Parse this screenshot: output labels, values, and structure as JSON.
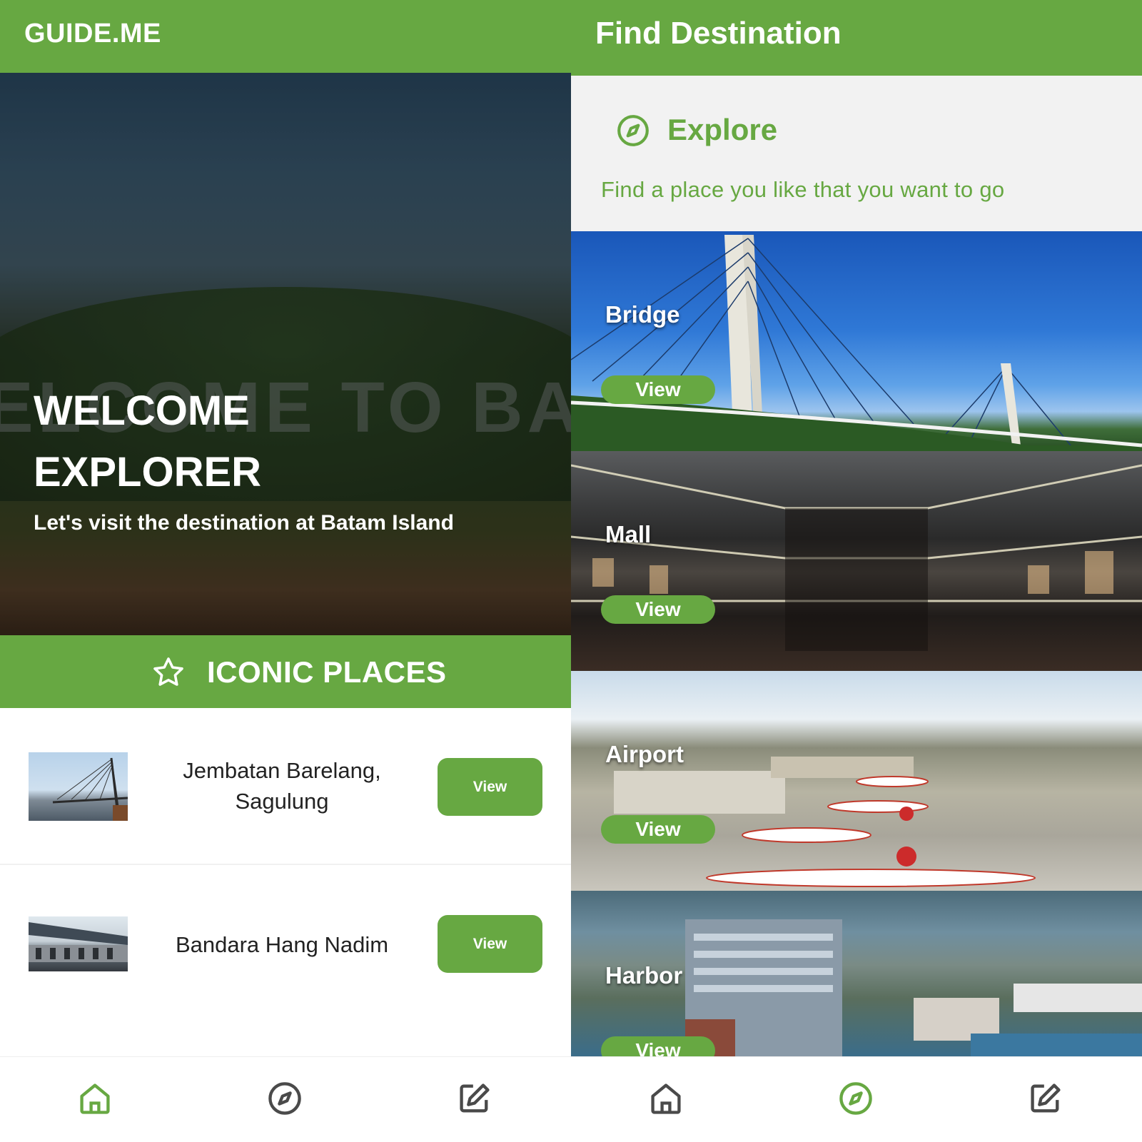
{
  "colors": {
    "primary": "#67a842",
    "white": "#ffffff",
    "panel": "#f2f2f2",
    "text": "#222222"
  },
  "left_screen": {
    "appbar": {
      "title": "GUIDE.ME"
    },
    "hero": {
      "background_sign_text": "ELCOME TO BATA",
      "title_line1": "WELCOME",
      "title_line2": "EXPLORER",
      "subtitle": "Let's visit the destination at Batam Island"
    },
    "section": {
      "icon": "star-icon",
      "title": "ICONIC PLACES"
    },
    "places": [
      {
        "name": "Jembatan Barelang, Sagulung",
        "button": "View"
      },
      {
        "name": "Bandara Hang Nadim",
        "button": "View"
      }
    ],
    "bottom_nav": [
      {
        "icon": "home-icon",
        "active": true
      },
      {
        "icon": "compass-icon",
        "active": false
      },
      {
        "icon": "edit-icon",
        "active": false
      }
    ]
  },
  "right_screen": {
    "appbar": {
      "title": "Find Destination"
    },
    "explore": {
      "icon": "compass-icon",
      "title": "Explore",
      "subtitle": "Find a place you like that you want to go"
    },
    "categories": [
      {
        "name": "Bridge",
        "button": "View"
      },
      {
        "name": "Mall",
        "button": "View"
      },
      {
        "name": "Airport",
        "button": "View"
      },
      {
        "name": "Harbor",
        "button": "View"
      }
    ],
    "bottom_nav": [
      {
        "icon": "home-icon",
        "active": false
      },
      {
        "icon": "compass-icon",
        "active": true
      },
      {
        "icon": "edit-icon",
        "active": false
      }
    ]
  }
}
